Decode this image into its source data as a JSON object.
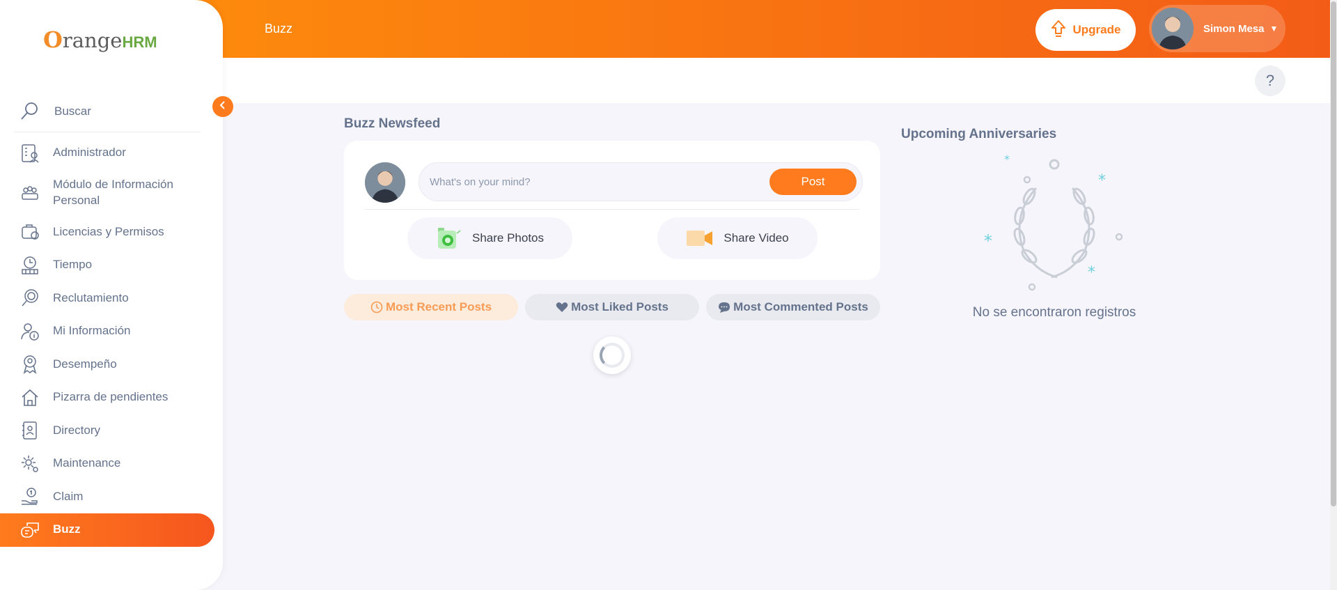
{
  "brand": {
    "o": "O",
    "rest": "range",
    "hrm": "HRM"
  },
  "topbar": {
    "title": "Buzz",
    "upgrade_label": "Upgrade",
    "user_name": "Simon Mesa"
  },
  "sidebar": {
    "search_label": "Buscar",
    "items": [
      {
        "label": "Administrador",
        "icon": "admin-icon"
      },
      {
        "label": "Módulo de Información Personal",
        "icon": "people-icon"
      },
      {
        "label": "Licencias y Permisos",
        "icon": "leave-icon"
      },
      {
        "label": "Tiempo",
        "icon": "time-icon"
      },
      {
        "label": "Reclutamiento",
        "icon": "recruitment-icon"
      },
      {
        "label": "Mi Información",
        "icon": "my-info-icon"
      },
      {
        "label": "Desempeño",
        "icon": "performance-icon"
      },
      {
        "label": "Pizarra de pendientes",
        "icon": "dashboard-icon"
      },
      {
        "label": "Directory",
        "icon": "directory-icon"
      },
      {
        "label": "Maintenance",
        "icon": "maintenance-icon"
      },
      {
        "label": "Claim",
        "icon": "claim-icon"
      },
      {
        "label": "Buzz",
        "icon": "buzz-icon",
        "active": true
      }
    ]
  },
  "help_label": "?",
  "feed": {
    "title": "Buzz Newsfeed",
    "post_placeholder": "What's on your mind?",
    "post_button": "Post",
    "share_photos": "Share Photos",
    "share_video": "Share Video",
    "filters": [
      {
        "label": "Most Recent Posts",
        "active": true
      },
      {
        "label": "Most Liked Posts"
      },
      {
        "label": "Most Commented Posts"
      }
    ]
  },
  "anniversaries": {
    "title": "Upcoming Anniversaries",
    "empty_text": "No se encontraron registros"
  },
  "colors": {
    "accent": "#ff7b1d",
    "accent_dark": "#f35c17",
    "text": "#64728c",
    "bg": "#f6f5fb"
  }
}
